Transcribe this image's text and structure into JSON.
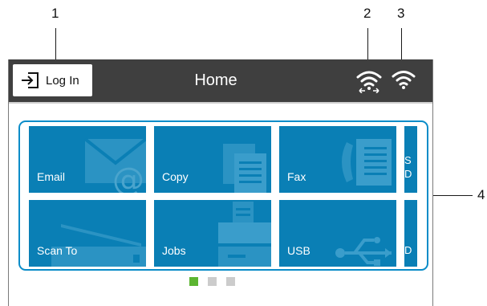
{
  "callouts": {
    "c1": "1",
    "c2": "2",
    "c3": "3",
    "c4": "4"
  },
  "header": {
    "login_label": "Log In",
    "title": "Home"
  },
  "tiles": [
    {
      "label": "Email",
      "icon": "envelope-icon"
    },
    {
      "label": "Copy",
      "icon": "document-copy-icon"
    },
    {
      "label": "Fax",
      "icon": "fax-icon"
    },
    {
      "label": "S\nD"
    },
    {
      "label": "Scan To",
      "icon": "scanner-icon"
    },
    {
      "label": "Jobs",
      "icon": "printer-icon"
    },
    {
      "label": "USB",
      "icon": "usb-icon"
    },
    {
      "label": "D"
    }
  ],
  "pager": {
    "pages": 3,
    "active_page": 1
  },
  "colors": {
    "tile": "#0a7fb5",
    "topbar": "#3f3f3f",
    "active_dot": "#5cb531",
    "inactive_dot": "#cccccc",
    "frame": "#0a8cc8"
  }
}
